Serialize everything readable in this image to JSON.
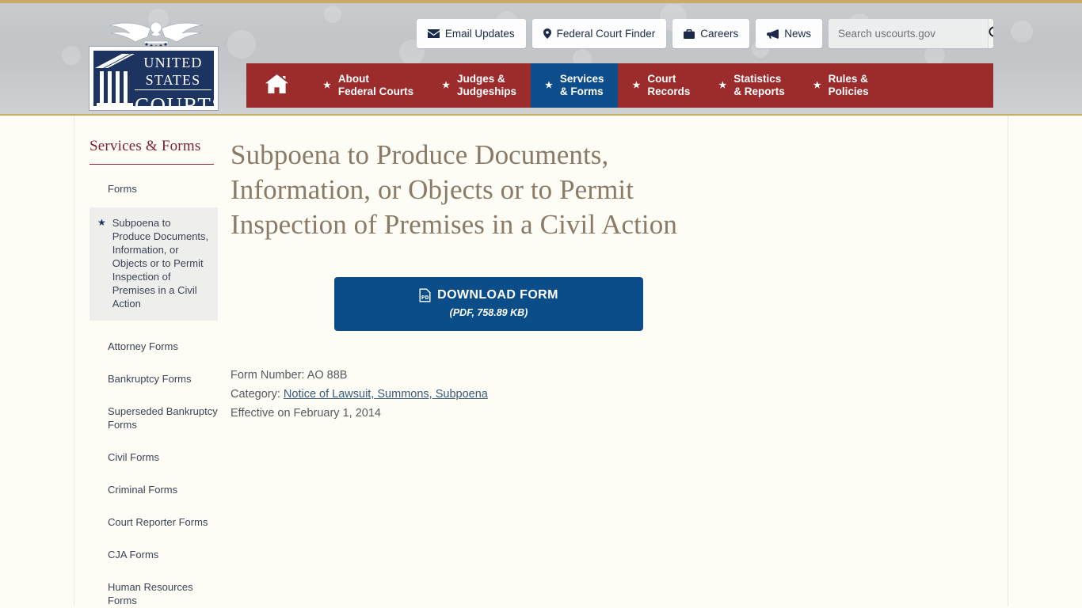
{
  "header": {
    "logo": {
      "line1": "UNITED STATES",
      "line2": "COURTS",
      "eagle_icon": "eagle-icon",
      "columns_icon": "courthouse-columns-icon"
    },
    "utility_nav": [
      {
        "label": "Email Updates",
        "icon": "envelope-icon"
      },
      {
        "label": "Federal Court Finder",
        "icon": "map-pin-icon"
      },
      {
        "label": "Careers",
        "icon": "briefcase-icon"
      },
      {
        "label": "News",
        "icon": "megaphone-icon"
      }
    ],
    "search": {
      "placeholder": "Search uscourts.gov",
      "value": "",
      "submit_icon": "search-icon"
    },
    "main_nav": {
      "home_icon": "home-icon",
      "star_icon": "star-icon",
      "items": [
        {
          "line1": "About",
          "line2": "Federal Courts",
          "active": false
        },
        {
          "line1": "Judges &",
          "line2": "Judgeships",
          "active": false
        },
        {
          "line1": "Services",
          "line2": "& Forms",
          "active": true
        },
        {
          "line1": "Court",
          "line2": "Records",
          "active": false
        },
        {
          "line1": "Statistics",
          "line2": "& Reports",
          "active": false
        },
        {
          "line1": "Rules &",
          "line2": "Policies",
          "active": false
        }
      ]
    }
  },
  "sidebar": {
    "title": "Services & Forms",
    "section_label": "Forms",
    "active_item": {
      "label": "Subpoena to Produce Documents, Information, or Objects or to Permit Inspection of Premises in a Civil Action",
      "star_icon": "star-icon"
    },
    "items": [
      {
        "label": "Attorney Forms"
      },
      {
        "label": "Bankruptcy Forms"
      },
      {
        "label": "Superseded Bankruptcy Forms"
      },
      {
        "label": "Civil Forms"
      },
      {
        "label": "Criminal Forms"
      },
      {
        "label": "Court Reporter Forms"
      },
      {
        "label": "CJA Forms"
      },
      {
        "label": "Human Resources Forms"
      }
    ]
  },
  "main": {
    "page_title": "Subpoena to Produce Documents, Information, or Objects or to Permit Inspection of Premises in a Civil Action",
    "download": {
      "label": "DOWNLOAD FORM",
      "sublabel": "(PDF, 758.89 KB)",
      "icon": "pdf-file-icon"
    },
    "meta": {
      "form_number_key": "Form Number:",
      "form_number_value": "AO 88B",
      "category_key": "Category:",
      "category_value": "Notice of Lawsuit, Summons, Subpoena",
      "effective": "Effective on February 1, 2014"
    }
  },
  "colors": {
    "nav_red": "#9c2b2b",
    "nav_active_blue": "#0d4d8c",
    "download_blue": "#0b4d89",
    "gold_rule": "#c9ab63",
    "sidebar_heading": "#7c2231",
    "title_brown": "#8a7a68",
    "page_background": "#fdfcf5"
  }
}
